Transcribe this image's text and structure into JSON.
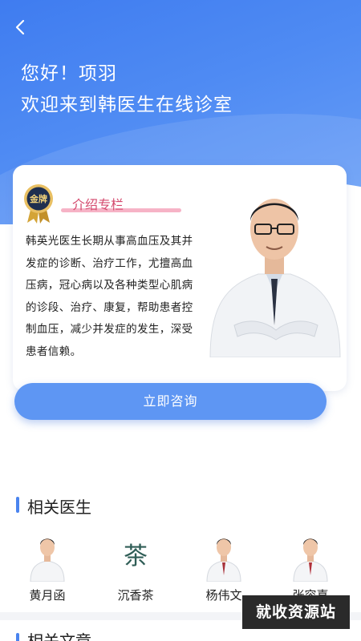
{
  "header": {
    "greeting": "您好！项羽",
    "welcome": "欢迎来到韩医生在线诊室",
    "back_icon": "chevron-left-icon"
  },
  "intro_card": {
    "badge_text": "金牌",
    "column_title": "介绍专栏",
    "description": "韩英光医生长期从事高血压及其并发症的诊断、治疗工作，尤擅高血压病，冠心病以及各种类型心肌病的诊段、治疗、康复，帮助患者控制血压，减少并发症的发生，深受患者信赖。"
  },
  "consult_button": {
    "label": "立即咨询"
  },
  "related_doctors": {
    "title": "相关医生",
    "items": [
      {
        "name": "黄月函",
        "avatar": "doctor-avatar"
      },
      {
        "name": "沉香茶",
        "avatar": "tea-logo",
        "logo_char": "茶"
      },
      {
        "name": "杨伟文",
        "avatar": "doctor-avatar"
      },
      {
        "name": "张容喜",
        "avatar": "doctor-avatar"
      }
    ]
  },
  "related_articles": {
    "title": "相关文章"
  },
  "watermark": {
    "text": "就收资源站"
  },
  "colors": {
    "accent": "#4a84ef",
    "button": "#5e96f3",
    "column_title": "#d44a6e",
    "hero": "#3f7cf0"
  }
}
